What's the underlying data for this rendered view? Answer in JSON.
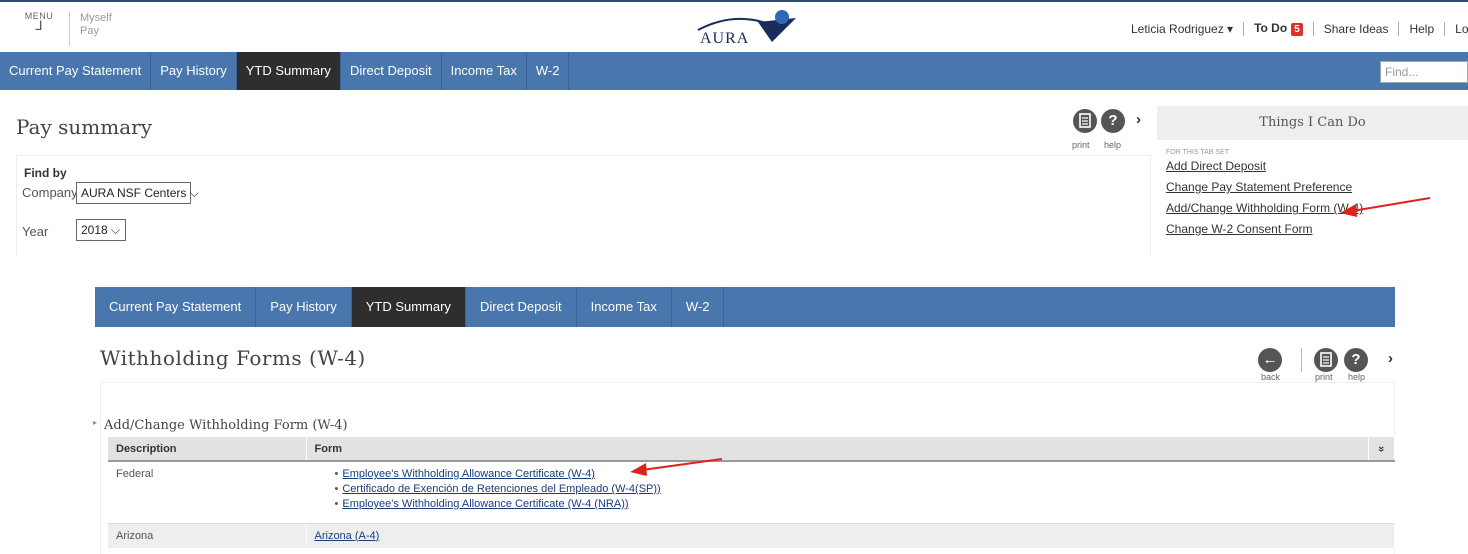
{
  "header": {
    "menu_label": "MENU",
    "menu_glyph": "⅃",
    "crumb_top": "Myself",
    "crumb_bottom": "Pay",
    "logo_text": "AURA",
    "user_name": "Leticia Rodriguez ▾",
    "todo_label": "To Do",
    "todo_count": "5",
    "share_ideas": "Share Ideas",
    "help": "Help",
    "logout": "Logout"
  },
  "nav": {
    "tabs": [
      "Current Pay Statement",
      "Pay History",
      "YTD Summary",
      "Direct Deposit",
      "Income Tax",
      "W-2"
    ],
    "active_tab": "YTD Summary",
    "find_placeholder": "Find..."
  },
  "pay_summary": {
    "title": "Pay summary",
    "print_label": "print",
    "help_label": "help",
    "find_by_title": "Find by",
    "company_label": "Company",
    "company_value": "AURA NSF Centers",
    "year_label": "Year",
    "year_value": "2018"
  },
  "things_i_can_do": {
    "heading": "Things I Can Do",
    "subheading": "FOR THIS TAB SET",
    "links": [
      "Add Direct Deposit",
      "Change Pay Statement Preference",
      "Add/Change Withholding Form (W-4)",
      "Change W-2 Consent Form"
    ]
  },
  "withholding": {
    "tabs": [
      "Current Pay Statement",
      "Pay History",
      "YTD Summary",
      "Direct Deposit",
      "Income Tax",
      "W-2"
    ],
    "active_tab": "YTD Summary",
    "title": "Withholding Forms (W-4)",
    "back_label": "back",
    "print_label": "print",
    "help_label": "help",
    "section_title": "Add/Change Withholding Form (W-4)",
    "table": {
      "headers": [
        "Description",
        "Form"
      ],
      "collapse_glyph": "»",
      "rows": [
        {
          "description": "Federal",
          "forms": [
            "Employee's Withholding Allowance Certificate (W-4)",
            "Certificado de Exención de Retenciones del Empleado (W-4(SP))",
            "Employee's Withholding Allowance Certificate (W-4 (NRA))"
          ]
        },
        {
          "description": "Arizona",
          "forms": [
            "Arizona (A-4)"
          ]
        }
      ]
    }
  },
  "colors": {
    "nav_blue": "#4876ad",
    "active_tab": "#2e2e2e",
    "badge_red": "#d9322b",
    "annotation_arrow": "#e0201b"
  }
}
